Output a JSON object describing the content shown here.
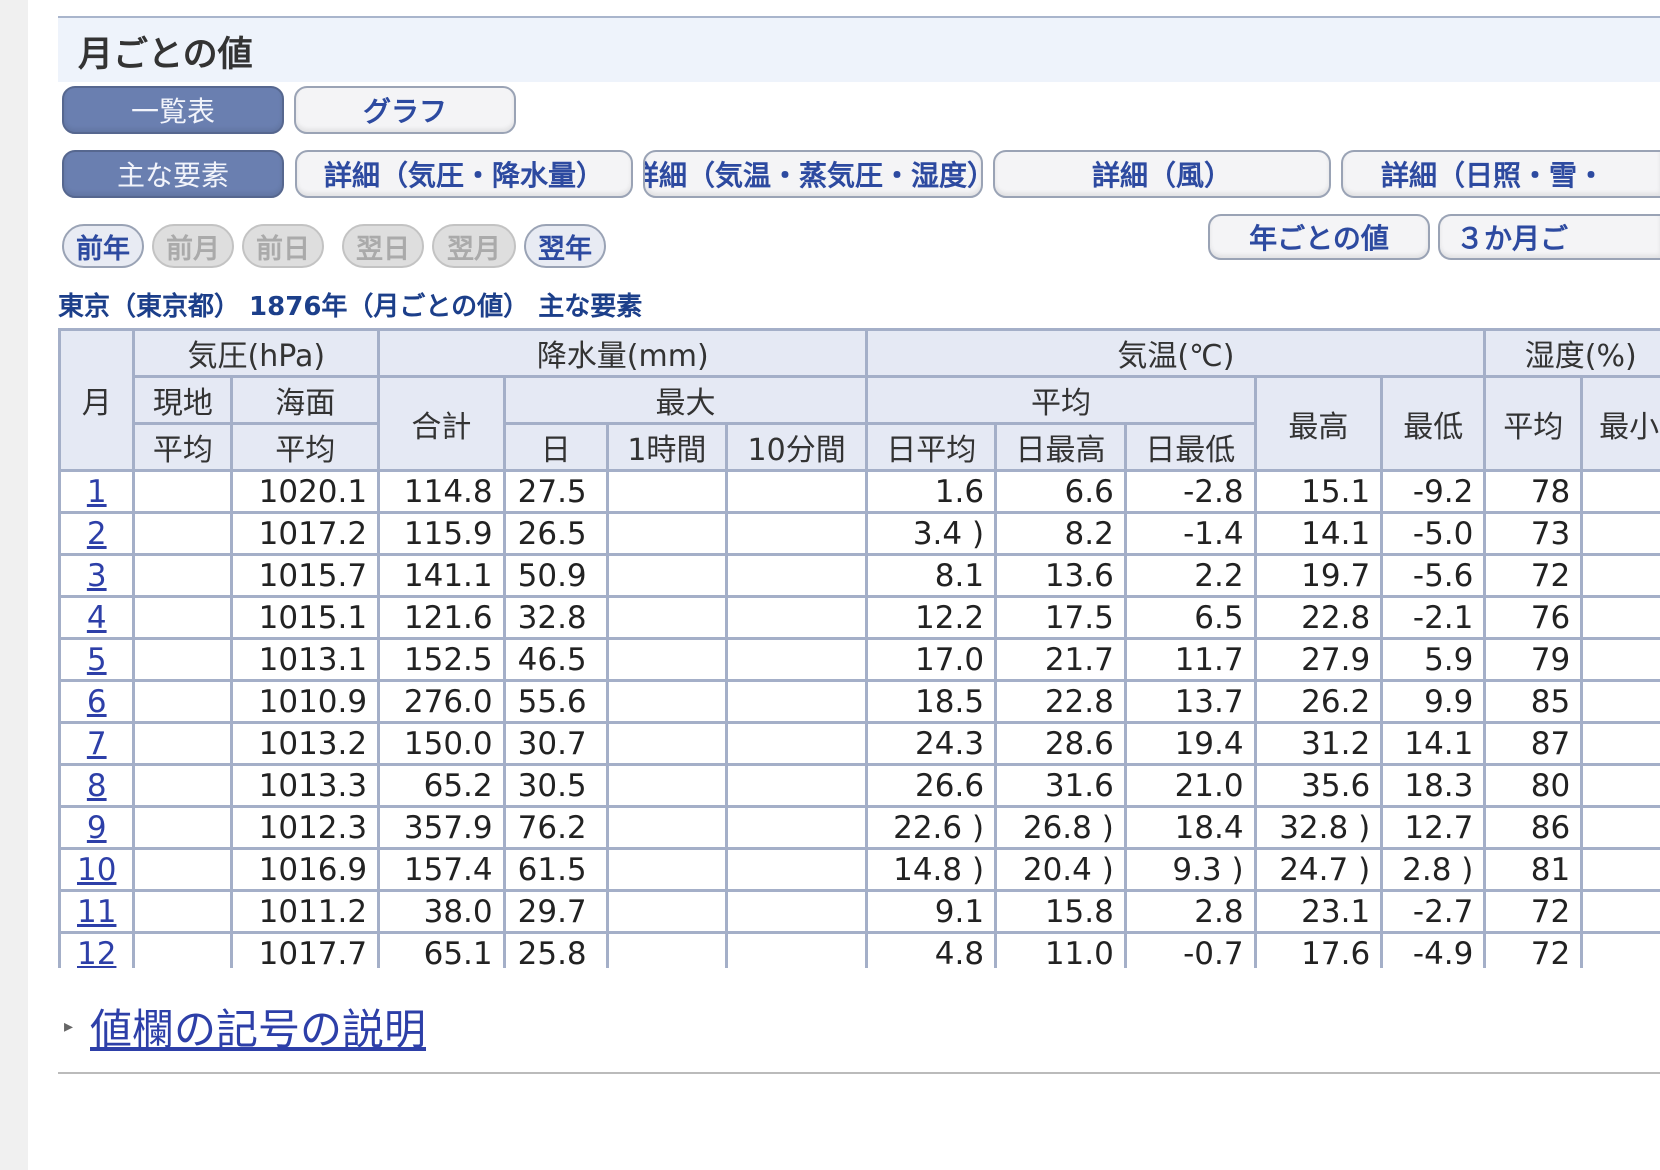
{
  "section_title": "月ごとの値",
  "view_tabs": [
    {
      "label": "一覧表",
      "active": true
    },
    {
      "label": "グラフ",
      "active": false
    }
  ],
  "element_tabs": [
    {
      "label": "主な要素",
      "active": true
    },
    {
      "label": "詳細（気圧・降水量）",
      "active": false
    },
    {
      "label": "詳細（気温・蒸気圧・湿度）",
      "active": false
    },
    {
      "label": "詳細（風）",
      "active": false
    },
    {
      "label": "詳細（日照・雪・",
      "active": false
    }
  ],
  "nav": {
    "prev_year": "前年",
    "prev_month": "前月",
    "prev_day": "前日",
    "next_day": "翌日",
    "next_month": "翌月",
    "next_year": "翌年",
    "yearly": "年ごとの値",
    "three_month": "３か月ご"
  },
  "caption": "東京（東京都） 1876年（月ごとの値） 主な要素",
  "table": {
    "h1": {
      "month": "月",
      "pressure": "気圧(hPa)",
      "precip": "降水量(mm)",
      "temp": "気温(℃)",
      "humidity": "湿度(%)"
    },
    "h2": {
      "local": "現地",
      "sea": "海面",
      "total": "合計",
      "max": "最大",
      "avg": "平均",
      "high": "最高",
      "low": "最低",
      "hum_avg": "平均",
      "hum_min": "最小"
    },
    "h3": {
      "local_avg": "平均",
      "sea_avg": "平均",
      "day": "日",
      "hour1": "1時間",
      "min10": "10分間",
      "daily_avg": "日平均",
      "daily_max": "日最高",
      "daily_min": "日最低"
    },
    "rows": [
      {
        "m": "1",
        "lp": "",
        "sp": "1020.1",
        "pt": "114.8",
        "pd": "27.5",
        "ph": "",
        "p10": "",
        "ta": "1.6",
        "tx": "6.6",
        "tn": "-2.8",
        "th": "15.1",
        "tl": "-9.2",
        "ha": "78",
        "hm": ""
      },
      {
        "m": "2",
        "lp": "",
        "sp": "1017.2",
        "pt": "115.9",
        "pd": "26.5",
        "ph": "",
        "p10": "",
        "ta": "3.4 )",
        "tx": "8.2",
        "tn": "-1.4",
        "th": "14.1",
        "tl": "-5.0",
        "ha": "73",
        "hm": ""
      },
      {
        "m": "3",
        "lp": "",
        "sp": "1015.7",
        "pt": "141.1",
        "pd": "50.9",
        "ph": "",
        "p10": "",
        "ta": "8.1",
        "tx": "13.6",
        "tn": "2.2",
        "th": "19.7",
        "tl": "-5.6",
        "ha": "72",
        "hm": ""
      },
      {
        "m": "4",
        "lp": "",
        "sp": "1015.1",
        "pt": "121.6",
        "pd": "32.8",
        "ph": "",
        "p10": "",
        "ta": "12.2",
        "tx": "17.5",
        "tn": "6.5",
        "th": "22.8",
        "tl": "-2.1",
        "ha": "76",
        "hm": ""
      },
      {
        "m": "5",
        "lp": "",
        "sp": "1013.1",
        "pt": "152.5",
        "pd": "46.5",
        "ph": "",
        "p10": "",
        "ta": "17.0",
        "tx": "21.7",
        "tn": "11.7",
        "th": "27.9",
        "tl": "5.9",
        "ha": "79",
        "hm": ""
      },
      {
        "m": "6",
        "lp": "",
        "sp": "1010.9",
        "pt": "276.0",
        "pd": "55.6",
        "ph": "",
        "p10": "",
        "ta": "18.5",
        "tx": "22.8",
        "tn": "13.7",
        "th": "26.2",
        "tl": "9.9",
        "ha": "85",
        "hm": ""
      },
      {
        "m": "7",
        "lp": "",
        "sp": "1013.2",
        "pt": "150.0",
        "pd": "30.7",
        "ph": "",
        "p10": "",
        "ta": "24.3",
        "tx": "28.6",
        "tn": "19.4",
        "th": "31.2",
        "tl": "14.1",
        "ha": "87",
        "hm": ""
      },
      {
        "m": "8",
        "lp": "",
        "sp": "1013.3",
        "pt": "65.2",
        "pd": "30.5",
        "ph": "",
        "p10": "",
        "ta": "26.6",
        "tx": "31.6",
        "tn": "21.0",
        "th": "35.6",
        "tl": "18.3",
        "ha": "80",
        "hm": ""
      },
      {
        "m": "9",
        "lp": "",
        "sp": "1012.3",
        "pt": "357.9",
        "pd": "76.2",
        "ph": "",
        "p10": "",
        "ta": "22.6 )",
        "tx": "26.8 )",
        "tn": "18.4",
        "th": "32.8 )",
        "tl": "12.7",
        "ha": "86",
        "hm": ""
      },
      {
        "m": "10",
        "lp": "",
        "sp": "1016.9",
        "pt": "157.4",
        "pd": "61.5",
        "ph": "",
        "p10": "",
        "ta": "14.8 )",
        "tx": "20.4 )",
        "tn": "9.3 )",
        "th": "24.7 )",
        "tl": "2.8 )",
        "ha": "81",
        "hm": ""
      },
      {
        "m": "11",
        "lp": "",
        "sp": "1011.2",
        "pt": "38.0",
        "pd": "29.7",
        "ph": "",
        "p10": "",
        "ta": "9.1",
        "tx": "15.8",
        "tn": "2.8",
        "th": "23.1",
        "tl": "-2.7",
        "ha": "72",
        "hm": ""
      },
      {
        "m": "12",
        "lp": "",
        "sp": "1017.7",
        "pt": "65.1",
        "pd": "25.8",
        "ph": "",
        "p10": "",
        "ta": "4.8",
        "tx": "11.0",
        "tn": "-0.7",
        "th": "17.6",
        "tl": "-4.9",
        "ha": "72",
        "hm": ""
      }
    ]
  },
  "legend_link": "値欄の記号の説明"
}
